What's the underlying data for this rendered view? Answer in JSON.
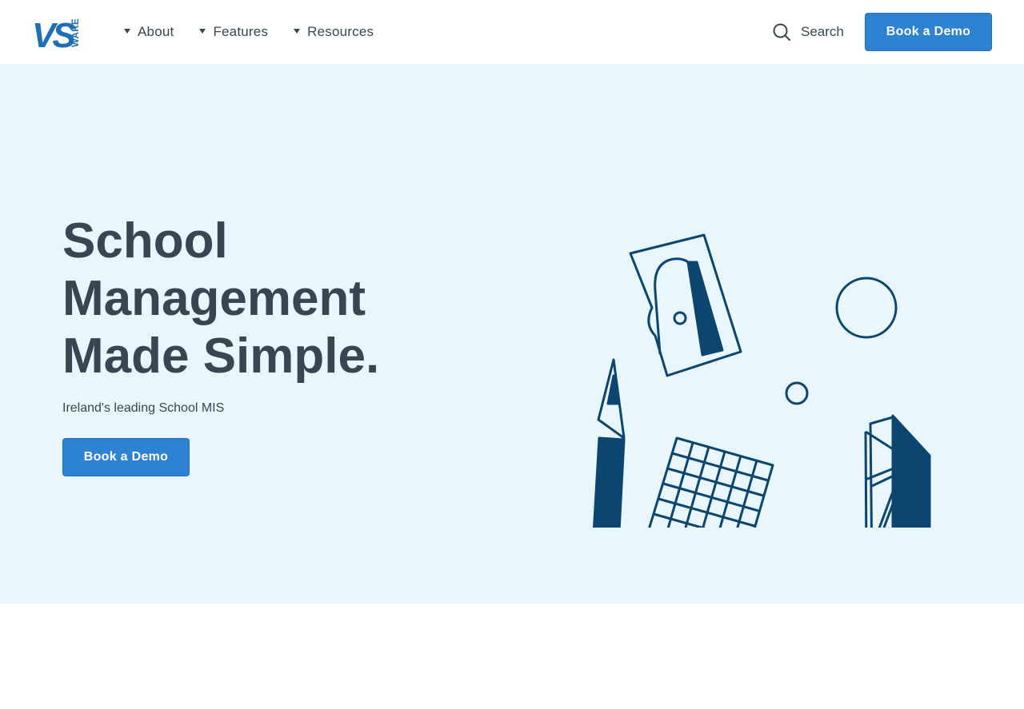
{
  "brand": {
    "logo_text": "VS",
    "logo_suffix": "WARE",
    "logo_color": "#1e6fb5"
  },
  "nav": {
    "items": [
      {
        "label": "About"
      },
      {
        "label": "Features"
      },
      {
        "label": "Resources"
      }
    ],
    "search_label": "Search",
    "cta_label": "Book a Demo"
  },
  "hero": {
    "headline_lines": [
      "School",
      "Management",
      "Made Simple."
    ],
    "subtitle": "Ireland's leading School MIS",
    "cta_label": "Book a Demo",
    "background_color": "#e9f6fd",
    "illustration_color": "#0c456f"
  },
  "colors": {
    "accent": "#2d82d2",
    "text": "#37474f"
  }
}
